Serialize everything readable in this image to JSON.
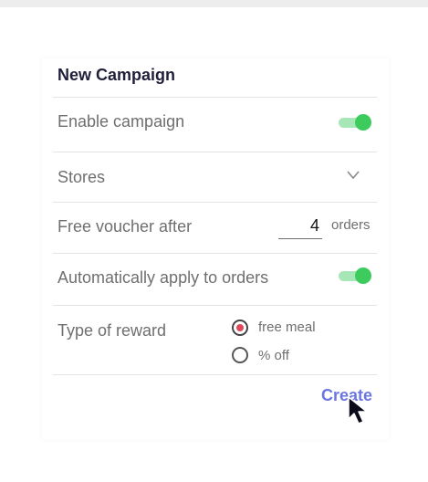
{
  "header": {
    "title": "New Campaign"
  },
  "rows": {
    "enable_campaign": {
      "label": "Enable campaign",
      "toggle_on": true
    },
    "stores": {
      "label": "Stores",
      "icon": "chevron-down-icon"
    },
    "free_voucher": {
      "label": "Free voucher after",
      "value": "4",
      "unit": "orders"
    },
    "auto_apply": {
      "label": "Automatically apply to orders",
      "toggle_on": true
    },
    "reward_type": {
      "label": "Type of reward",
      "options": [
        {
          "label": "free meal",
          "selected": true
        },
        {
          "label": "% off",
          "selected": false
        }
      ]
    }
  },
  "actions": {
    "create_label": "Create"
  },
  "colors": {
    "accent": "#6b76e0",
    "toggle_on": "#3ecb5e",
    "toggle_track": "#a7e6b6",
    "radio_selected": "#e0485b",
    "title": "#1f1f3a"
  },
  "icons": {
    "cursor": "mouse-pointer-icon"
  }
}
